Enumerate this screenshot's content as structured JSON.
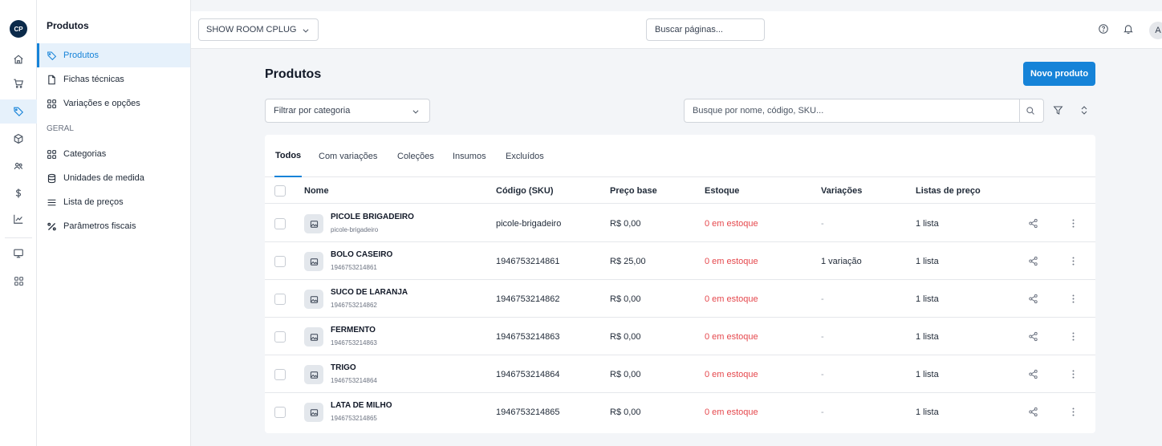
{
  "rail": {
    "logo": "CP",
    "items": [
      {
        "icon": "home-icon"
      },
      {
        "icon": "cart-icon"
      },
      {
        "icon": "tag-icon",
        "active": true
      },
      {
        "icon": "box-icon"
      },
      {
        "icon": "users-icon"
      },
      {
        "icon": "dollar-icon"
      },
      {
        "icon": "chart-icon"
      },
      {
        "icon": "monitor-icon"
      },
      {
        "icon": "grid-icon"
      }
    ]
  },
  "submenu": {
    "title": "Produtos",
    "items": [
      {
        "label": "Produtos",
        "icon": "tag-icon",
        "active": true
      },
      {
        "label": "Fichas técnicas",
        "icon": "document-icon"
      },
      {
        "label": "Variações e opções",
        "icon": "grid-icon"
      }
    ],
    "section_label": "GERAL",
    "general_items": [
      {
        "label": "Categorias",
        "icon": "grid-icon"
      },
      {
        "label": "Unidades de medida",
        "icon": "database-icon"
      },
      {
        "label": "Lista de preços",
        "icon": "list-icon"
      },
      {
        "label": "Parâmetros fiscais",
        "icon": "percent-icon"
      }
    ]
  },
  "topbar": {
    "store": "SHOW ROOM CPLUG",
    "search_placeholder": "Buscar páginas...",
    "avatar": "A"
  },
  "main": {
    "title": "Produtos",
    "new_button": "Novo produto",
    "category_filter": "Filtrar por categoria",
    "search_placeholder": "Busque por nome, código, SKU...",
    "tabs": [
      "Todos",
      "Com variações",
      "Coleções",
      "Insumos",
      "Excluídos"
    ],
    "active_tab": "Todos",
    "columns": [
      "Nome",
      "Código (SKU)",
      "Preço base",
      "Estoque",
      "Variações",
      "Listas de preço"
    ],
    "rows": [
      {
        "name": "PICOLE BRIGADEIRO",
        "sub": "picole-brigadeiro",
        "code": "picole-brigadeiro",
        "price": "R$ 0,00",
        "stock": "0 em estoque",
        "variations": "-",
        "lists": "1 lista"
      },
      {
        "name": "BOLO CASEIRO",
        "sub": "1946753214861",
        "code": "1946753214861",
        "price": "R$ 25,00",
        "stock": "0 em estoque",
        "variations": "1 variação",
        "lists": "1 lista"
      },
      {
        "name": "SUCO DE LARANJA",
        "sub": "1946753214862",
        "code": "1946753214862",
        "price": "R$ 0,00",
        "stock": "0 em estoque",
        "variations": "-",
        "lists": "1 lista"
      },
      {
        "name": "FERMENTO",
        "sub": "1946753214863",
        "code": "1946753214863",
        "price": "R$ 0,00",
        "stock": "0 em estoque",
        "variations": "-",
        "lists": "1 lista"
      },
      {
        "name": "TRIGO",
        "sub": "1946753214864",
        "code": "1946753214864",
        "price": "R$ 0,00",
        "stock": "0 em estoque",
        "variations": "-",
        "lists": "1 lista"
      },
      {
        "name": "LATA DE MILHO",
        "sub": "1946753214865",
        "code": "1946753214865",
        "price": "R$ 0,00",
        "stock": "0 em estoque",
        "variations": "-",
        "lists": "1 lista"
      }
    ]
  },
  "colors": {
    "accent": "#1683d8",
    "stock_alert": "#e5484d",
    "background": "#f3f5f8"
  }
}
